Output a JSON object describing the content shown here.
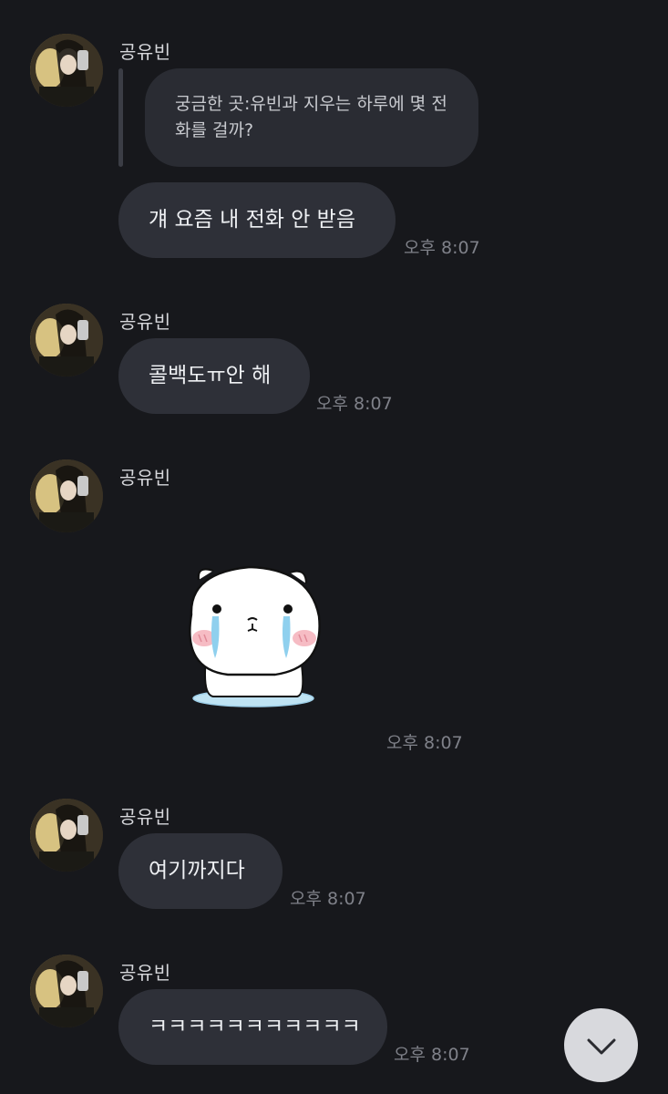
{
  "messages": [
    {
      "sender": "공유빈",
      "quote": "궁금한 곳:유빈과 지우는 하루에 몇 전화를 걸까?",
      "text": "걔 요즘 내 전화 안 받음",
      "time": "오후 8:07"
    },
    {
      "sender": "공유빈",
      "text": "콜백도ㅠ안 해",
      "time": "오후 8:07"
    },
    {
      "sender": "공유빈",
      "sticker": "crying-bear-sticker",
      "time": "오후 8:07"
    },
    {
      "sender": "공유빈",
      "text": "여기까지다",
      "time": "오후 8:07"
    },
    {
      "sender": "공유빈",
      "text": "ㅋㅋㅋㅋㅋㅋㅋㅋㅋㅋㅋ",
      "time": "오후 8:07"
    }
  ],
  "scroll_button_icon": "chevron-down-icon",
  "colors": {
    "background": "#17181c",
    "bubble": "#2e3038",
    "text": "#eef0f3",
    "time": "#7f8189"
  }
}
